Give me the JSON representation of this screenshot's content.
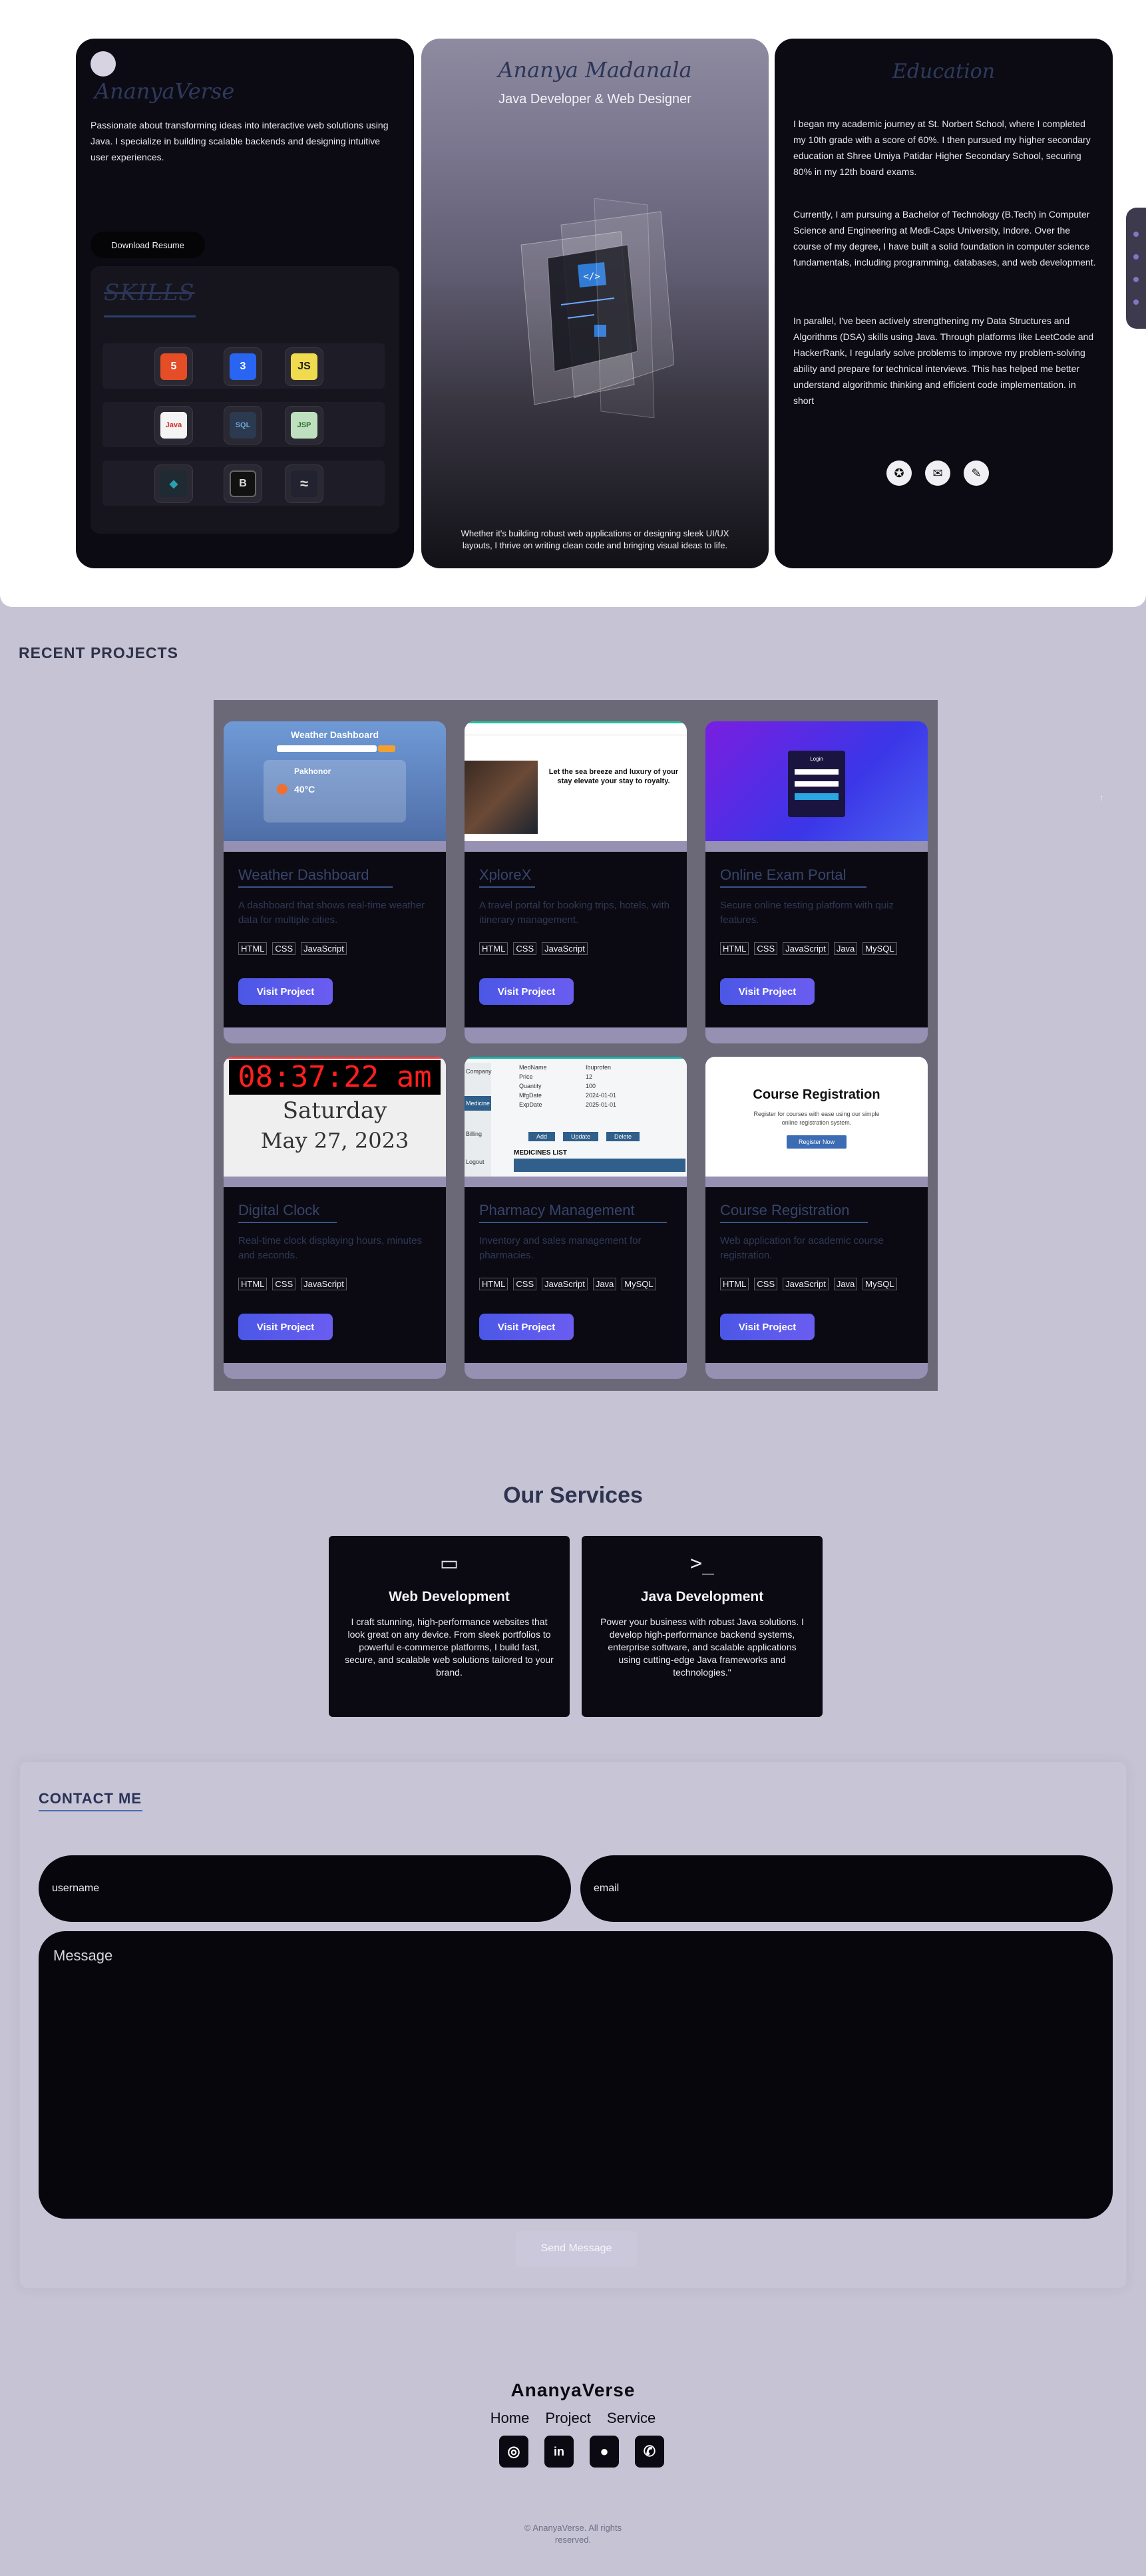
{
  "hero": {
    "brand": "AnanyaVerse",
    "intro": "Passionate about transforming ideas into interactive web solutions using Java. I specialize in building scalable backends and designing intuitive user experiences.",
    "resume_label": "Download Resume",
    "skills_title": "SKILLS",
    "skills": [
      {
        "icon": "html5-icon",
        "label": "5",
        "color": "#e44d26"
      },
      {
        "icon": "css3-icon",
        "label": "3",
        "color": "#2965f1"
      },
      {
        "icon": "javascript-icon",
        "label": "JS",
        "color": "#f0db4f"
      },
      {
        "icon": "java-icon",
        "label": "Java",
        "color": "#f4f4f4"
      },
      {
        "icon": "mysql-icon",
        "label": "SQL",
        "color": "#2d6a8f"
      },
      {
        "icon": "jsp-icon",
        "label": "JSP",
        "color": "#bfe0bf"
      },
      {
        "icon": "database-icon",
        "label": "◆",
        "color": "#2a9fb0"
      },
      {
        "icon": "bootstrap-icon",
        "label": "B",
        "color": "#111111"
      },
      {
        "icon": "tailwind-icon",
        "label": "≈",
        "color": "#222230"
      }
    ],
    "name": "Ananya Madanala",
    "role": "Java Developer & Web Designer",
    "quote": "Whether it's building robust web applications or designing sleek UI/UX layouts, I thrive on writing clean code and bringing visual ideas to life.",
    "education_title": "Education",
    "education": [
      "I began my academic journey at St. Norbert School, where I completed my 10th grade with a score of 60%. I then pursued my higher secondary education at Shree Umiya Patidar Higher Secondary School, securing 80% in my 12th board exams.",
      "Currently, I am pursuing a Bachelor of Technology (B.Tech) in Computer Science and Engineering at Medi-Caps University, Indore. Over the course of my degree, I have built a solid foundation in computer science fundamentals, including programming, databases, and web development.",
      "In parallel, I've been actively strengthening my Data Structures and Algorithms (DSA) skills using Java. Through platforms like LeetCode and HackerRank, I regularly solve problems to improve my problem-solving ability and prepare for technical interviews. This has helped me better understand algorithmic thinking and efficient code implementation. in short"
    ],
    "edu_icons": [
      "award-icon",
      "chat-icon",
      "code-icon"
    ]
  },
  "projects": {
    "section_title": "RECENT PROJECTS",
    "visit_label": "Visit Project",
    "items": [
      {
        "title": "Weather Dashboard",
        "desc": "A dashboard that shows real-time weather data for multiple cities.",
        "tags": [
          "HTML",
          "CSS",
          "JavaScript"
        ],
        "shot": {
          "heading": "Weather Dashboard",
          "city": "Pakhonor",
          "temp": "40°C"
        }
      },
      {
        "title": "XploreX",
        "desc": "A travel portal for booking trips, hotels, with itinerary management.",
        "tags": [
          "HTML",
          "CSS",
          "JavaScript"
        ],
        "shot": {
          "heading": "Let the sea breeze and luxury of your stay elevate your stay to royalty."
        }
      },
      {
        "title": "Online Exam Portal",
        "desc": "Secure online testing platform with quiz features.",
        "tags": [
          "HTML",
          "CSS",
          "JavaScript",
          "Java",
          "MySQL"
        ],
        "shot": {
          "heading": "Login"
        }
      },
      {
        "title": "Digital Clock",
        "desc": "Real-time clock displaying hours, minutes and seconds.",
        "tags": [
          "HTML",
          "CSS",
          "JavaScript"
        ],
        "shot": {
          "time": "08:37:22 am",
          "day": "Saturday",
          "date": "May 27, 2023"
        }
      },
      {
        "title": "Pharmacy Management",
        "desc": "Inventory and sales management for pharmacies.",
        "tags": [
          "HTML",
          "CSS",
          "JavaScript",
          "Java",
          "MySQL"
        ],
        "shot": {
          "heading": "MEDICINES LIST",
          "rows": [
            [
              "MedName",
              "Ibuprofen"
            ],
            [
              "Price",
              "12"
            ],
            [
              "Quantity",
              "100"
            ],
            [
              "MfgDate",
              "2024-01-01"
            ],
            [
              "ExpDate",
              "2025-01-01"
            ]
          ],
          "buttons": [
            "Add",
            "Update",
            "Delete"
          ],
          "side": [
            "Company",
            "Medicine",
            "Billing",
            "Logout"
          ]
        }
      },
      {
        "title": "Course Registration",
        "desc": "Web application for academic course registration.",
        "tags": [
          "HTML",
          "CSS",
          "JavaScript",
          "Java",
          "MySQL"
        ],
        "shot": {
          "heading": "Course Registration",
          "sub": "Register for courses with ease using our simple online registration system.",
          "button": "Register Now"
        }
      }
    ]
  },
  "services": {
    "title": "Our Services",
    "items": [
      {
        "icon": "laptop-code-icon",
        "glyph": "▭",
        "title": "Web Development",
        "text": "I craft stunning, high-performance websites that look great on any device. From sleek portfolios to powerful e-commerce platforms, I build fast, secure, and scalable web solutions tailored to your brand."
      },
      {
        "icon": "terminal-icon",
        "glyph": ">_",
        "title": "Java Development",
        "text": "Power your business with robust Java solutions. I develop high-performance backend systems, enterprise software, and scalable applications using cutting-edge Java frameworks and technologies.\""
      }
    ]
  },
  "contact": {
    "title": "CONTACT ME",
    "username_placeholder": "username",
    "email_placeholder": "email",
    "message_placeholder": "Message",
    "send_label": "Send Message"
  },
  "footer": {
    "brand": "AnanyaVerse",
    "nav": [
      "Home",
      "Project",
      "Service"
    ],
    "socials": [
      {
        "icon": "instagram-icon",
        "glyph": "◎"
      },
      {
        "icon": "linkedin-icon",
        "glyph": "in"
      },
      {
        "icon": "github-icon",
        "glyph": "●"
      },
      {
        "icon": "phone-icon",
        "glyph": "✆"
      }
    ],
    "copyright": "© AnanyaVerse. All rights reserved."
  },
  "colors": {
    "accent": "#5b5ae8",
    "panel": "#0c0b14",
    "page_bg": "#c5c3d4"
  }
}
